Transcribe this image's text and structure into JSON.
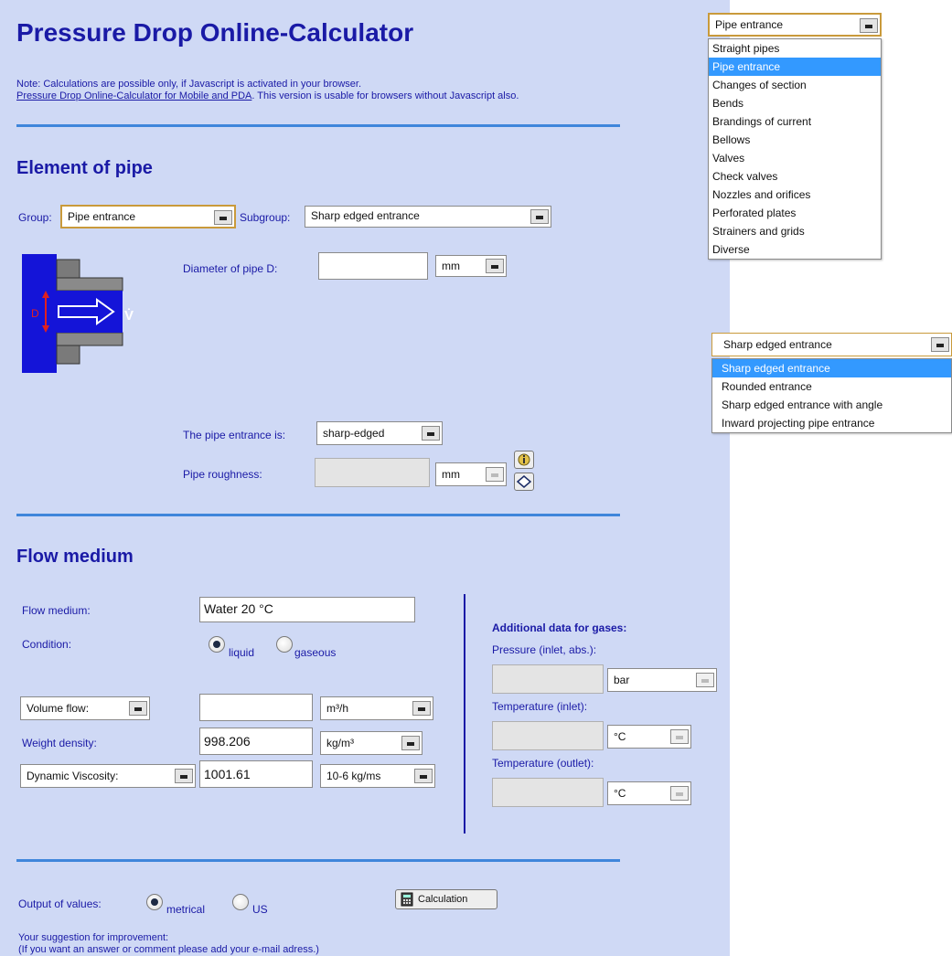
{
  "header": {
    "title": "Pressure Drop Online-Calculator",
    "note_line1": "Note: Calculations are possible only, if Javascript is activated in your browser.",
    "note_link": "Pressure Drop Online-Calculator for Mobile and PDA",
    "note_line2_tail": ". This version is usable for browsers without Javascript also."
  },
  "element_section": {
    "heading": "Element of pipe",
    "group_label": "Group:",
    "group_value": "Pipe entrance",
    "subgroup_label": "Subgroup:",
    "subgroup_value": "Sharp edged entrance",
    "diameter_label": "Diameter of pipe D:",
    "diameter_value": "",
    "diameter_unit": "mm",
    "entrance_label": "The pipe entrance is:",
    "entrance_value": "sharp-edged",
    "roughness_label": "Pipe roughness:",
    "roughness_value": "",
    "roughness_unit": "mm",
    "diagram": {
      "d_label": "D",
      "v_label": "V̇"
    }
  },
  "flow_section": {
    "heading": "Flow medium",
    "medium_label": "Flow medium:",
    "medium_value": "Water 20 °C",
    "condition_label": "Condition:",
    "liquid_label": "liquid",
    "gaseous_label": "gaseous",
    "condition_selected": "liquid",
    "flow_type_value": "Volume flow:",
    "flow_value": "",
    "flow_unit": "m³/h",
    "density_label": "Weight density:",
    "density_value": "998.206",
    "density_unit": "kg/m³",
    "viscosity_type_value": "Dynamic Viscosity:",
    "viscosity_value": "1001.61",
    "viscosity_unit": "10-6 kg/ms",
    "gas": {
      "heading": "Additional data for gases:",
      "pressure_label": "Pressure (inlet, abs.):",
      "pressure_value": "",
      "pressure_unit": "bar",
      "temp_in_label": "Temperature (inlet):",
      "temp_in_value": "",
      "temp_in_unit": "°C",
      "temp_out_label": "Temperature (outlet):",
      "temp_out_value": "",
      "temp_out_unit": "°C"
    }
  },
  "output_section": {
    "label": "Output of values:",
    "metrical_label": "metrical",
    "us_label": "US",
    "selected": "metrical",
    "calc_button": "Calculation",
    "suggestion_line1": "Your suggestion for improvement:",
    "suggestion_line2": "(If you want an answer or comment please add your e-mail adress.)"
  },
  "group_dropdown": {
    "value": "Pipe entrance",
    "selected_index": 1,
    "options": [
      "Straight pipes",
      "Pipe entrance",
      "Changes of section",
      "Bends",
      "Brandings of current",
      "Bellows",
      "Valves",
      "Check valves",
      "Nozzles and orifices",
      "Perforated plates",
      "Strainers and grids",
      "Diverse"
    ]
  },
  "subgroup_dropdown": {
    "value": "Sharp edged entrance",
    "selected_index": 0,
    "options": [
      "Sharp edged entrance",
      "Rounded entrance",
      "Sharp edged entrance with angle",
      "Inward projecting pipe entrance"
    ]
  },
  "colors": {
    "panel_bg": "#cfd9f5",
    "text": "#1a1aa6",
    "rule": "#3f86db",
    "highlight": "#3399ff"
  }
}
